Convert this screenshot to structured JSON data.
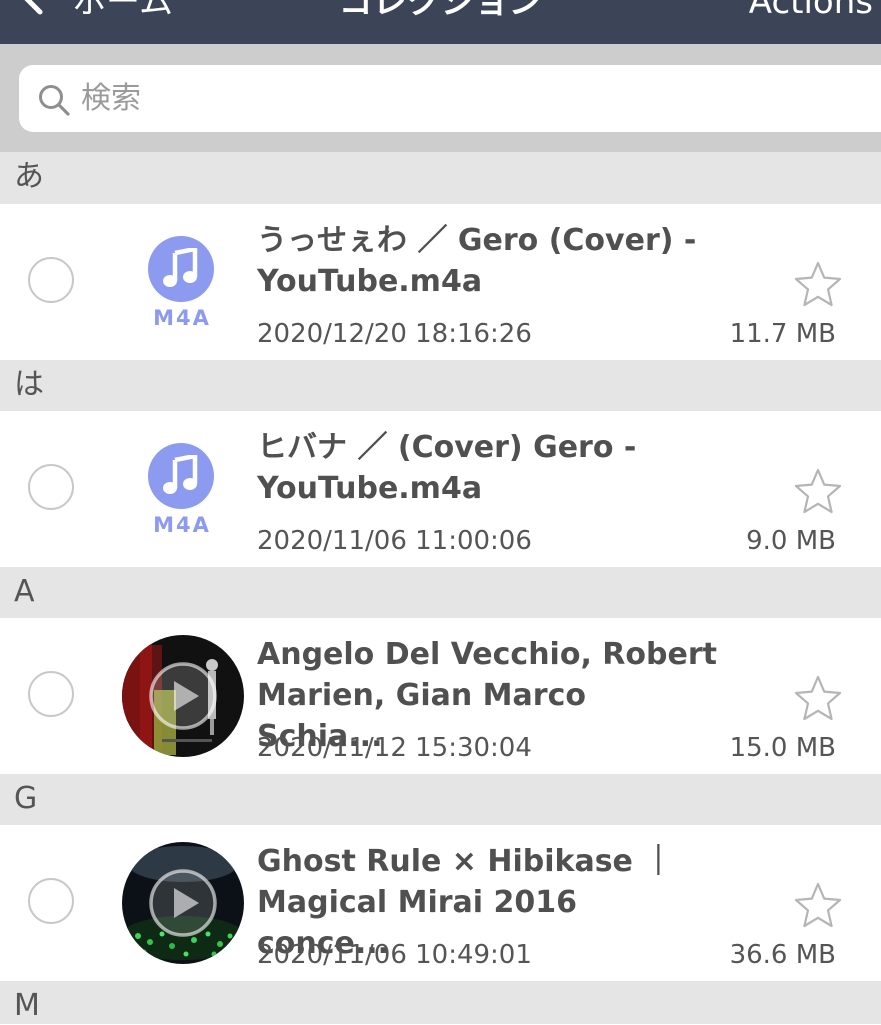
{
  "nav": {
    "back_label": "ホーム",
    "title": "コレクション",
    "actions_label": "Actions"
  },
  "search": {
    "placeholder": "検索"
  },
  "sections": [
    {
      "header": "あ",
      "items": [
        {
          "title": "うっせぇわ ／ Gero (Cover) -\nYouTube.m4a",
          "date": "2020/12/20 18:16:26",
          "size": "11.7 MB",
          "thumb": "audio",
          "ext": "M4A",
          "favorite": false
        }
      ]
    },
    {
      "header": "は",
      "items": [
        {
          "title": "ヒバナ ／ (Cover) Gero -\nYouTube.m4a",
          "date": "2020/11/06 11:00:06",
          "size": "9.0 MB",
          "thumb": "audio",
          "ext": "M4A",
          "favorite": false
        }
      ]
    },
    {
      "header": "A",
      "items": [
        {
          "title": "Angelo Del Vecchio, Robert\nMarien, Gian Marco Schia...",
          "date": "2020/11/12 15:30:04",
          "size": "15.0 MB",
          "thumb": "video",
          "favorite": false
        }
      ]
    },
    {
      "header": "G",
      "items": [
        {
          "title": "Ghost Rule × Hibikase ｜\nMagical Mirai 2016 conce...",
          "date": "2020/11/06 10:49:01",
          "size": "36.6 MB",
          "thumb": "video",
          "favorite": false
        }
      ]
    },
    {
      "header": "M",
      "items": []
    }
  ],
  "colors": {
    "navbar": "#3c4458",
    "audio_accent": "#8c9bf0",
    "section_bg": "#e5e5e5",
    "search_area_bg": "#cdcdcd"
  },
  "icons": {
    "back": "chevron-left-icon",
    "search": "magnifier-icon",
    "audio": "music-note-icon",
    "video": "play-icon",
    "favorite": "star-outline-icon",
    "select": "empty-circle-icon"
  }
}
